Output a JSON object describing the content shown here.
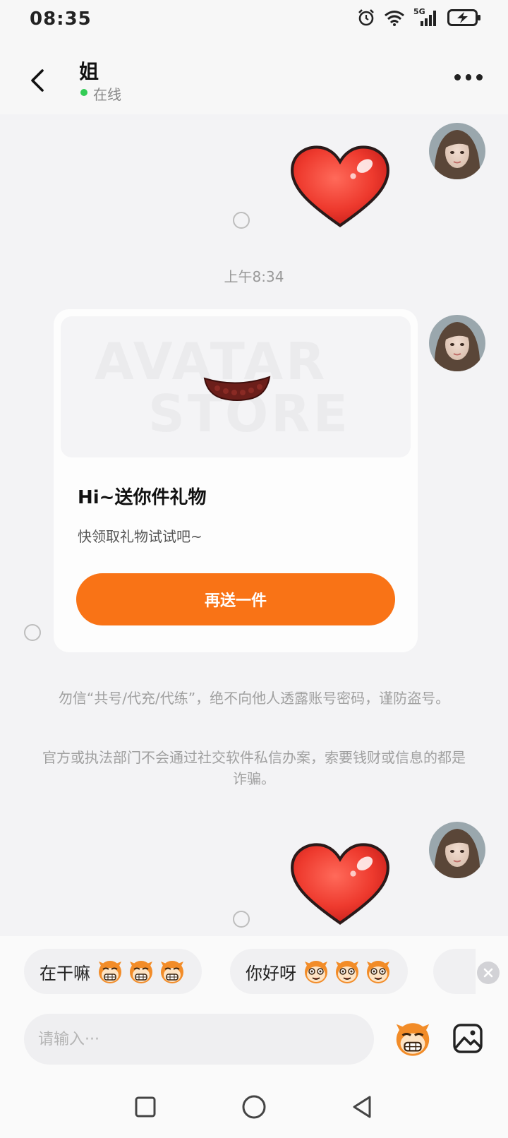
{
  "status_bar": {
    "time": "08:35",
    "network": "5G"
  },
  "header": {
    "name": "姐",
    "status": "在线"
  },
  "chat": {
    "timestamp": "上午8:34",
    "gift_card": {
      "watermark_top": "AVATAR",
      "watermark_bottom": "STORE",
      "title": "Hi~送你件礼物",
      "subtitle": "快领取礼物试试吧~",
      "button_label": "再送一件"
    },
    "notice_1": "勿信“共号/代充/代练”，绝不向他人透露账号密码，谨防盗号。",
    "notice_2": "官方或执法部门不会通过社交软件私信办案，索要钱财或信息的都是诈骗。"
  },
  "quick_replies": [
    {
      "text": "在干嘛"
    },
    {
      "text": "你好呀"
    }
  ],
  "input": {
    "placeholder": "请输入···"
  },
  "colors": {
    "accent": "#f97316",
    "online": "#33cc55",
    "heart": "#e8322a"
  }
}
